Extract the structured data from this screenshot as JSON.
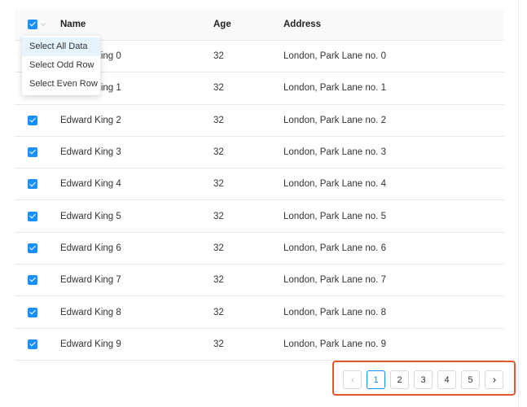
{
  "table": {
    "columns": {
      "name": "Name",
      "age": "Age",
      "address": "Address"
    },
    "rows": [
      {
        "name": "Edward King 0",
        "age": "32",
        "address": "London, Park Lane no. 0"
      },
      {
        "name": "Edward King 1",
        "age": "32",
        "address": "London, Park Lane no. 1"
      },
      {
        "name": "Edward King 2",
        "age": "32",
        "address": "London, Park Lane no. 2"
      },
      {
        "name": "Edward King 3",
        "age": "32",
        "address": "London, Park Lane no. 3"
      },
      {
        "name": "Edward King 4",
        "age": "32",
        "address": "London, Park Lane no. 4"
      },
      {
        "name": "Edward King 5",
        "age": "32",
        "address": "London, Park Lane no. 5"
      },
      {
        "name": "Edward King 6",
        "age": "32",
        "address": "London, Park Lane no. 6"
      },
      {
        "name": "Edward King 7",
        "age": "32",
        "address": "London, Park Lane no. 7"
      },
      {
        "name": "Edward King 8",
        "age": "32",
        "address": "London, Park Lane no. 8"
      },
      {
        "name": "Edward King 9",
        "age": "32",
        "address": "London, Park Lane no. 9"
      }
    ]
  },
  "selection_menu": {
    "items": [
      {
        "label": "Select All Data"
      },
      {
        "label": "Select Odd Row"
      },
      {
        "label": "Select Even Row"
      }
    ],
    "highlighted_index": 0
  },
  "pagination": {
    "pages": [
      "1",
      "2",
      "3",
      "4",
      "5"
    ],
    "current": "1",
    "prev_icon": "chevron-left-icon",
    "next_icon": "chevron-right-icon"
  },
  "colors": {
    "accent": "#1890ff",
    "highlight_box": "#e4572e",
    "menu_highlight": "#e6f4ff"
  }
}
